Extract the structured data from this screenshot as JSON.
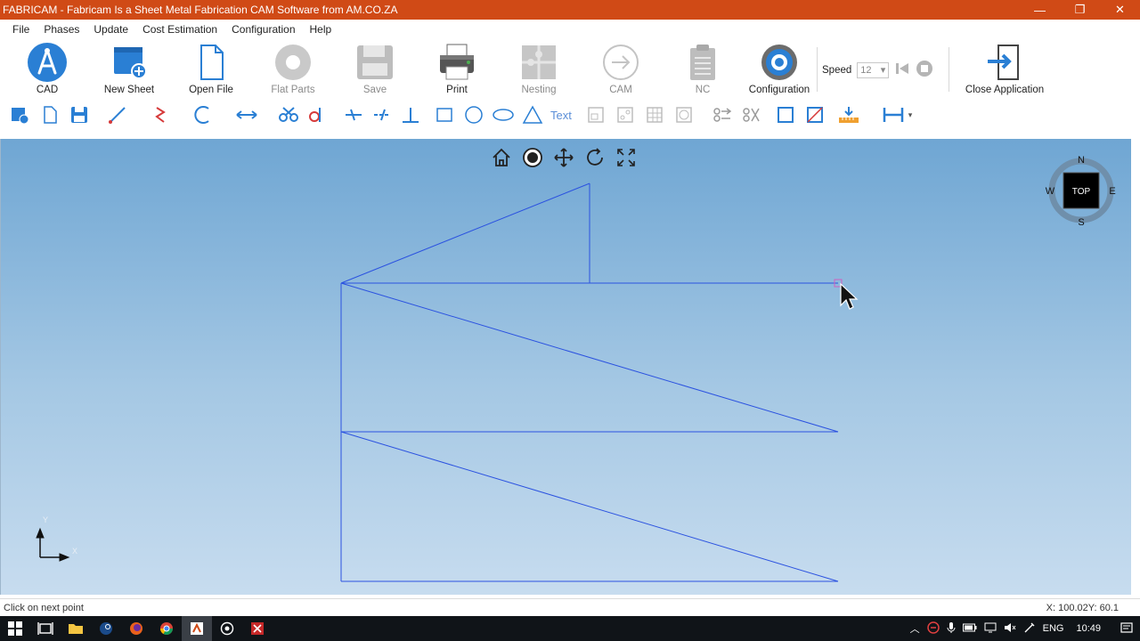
{
  "window": {
    "title": "FABRICAM - Fabricam Is a Sheet Metal Fabrication CAM Software from AM.CO.ZA",
    "controls": {
      "minimize": "—",
      "restore": "❐",
      "close": "✕"
    }
  },
  "menu": [
    "File",
    "Phases",
    "Update",
    "Cost Estimation",
    "Configuration",
    "Help"
  ],
  "ribbon": {
    "cad": "CAD",
    "new_sheet": "New Sheet",
    "open_file": "Open File",
    "flat_parts": "Flat Parts",
    "save": "Save",
    "print": "Print",
    "nesting": "Nesting",
    "cam": "CAM",
    "nc": "NC",
    "configuration": "Configuration",
    "speed_label": "Speed",
    "speed_value": "12",
    "close_application": "Close Application"
  },
  "tools": {
    "text_label": "Text"
  },
  "compass": {
    "n": "N",
    "s": "S",
    "e": "E",
    "w": "W",
    "view": "TOP"
  },
  "axes": {
    "x": "X",
    "y": "Y"
  },
  "status": {
    "message": "Click on next point",
    "coords": "X: 100.02Y: 60.1"
  },
  "taskbar": {
    "language": "ENG",
    "time": "10:49"
  },
  "colors": {
    "titlebar": "#d04a16",
    "accent_blue": "#2a7fd4",
    "drawing_line": "#2b52e0"
  }
}
